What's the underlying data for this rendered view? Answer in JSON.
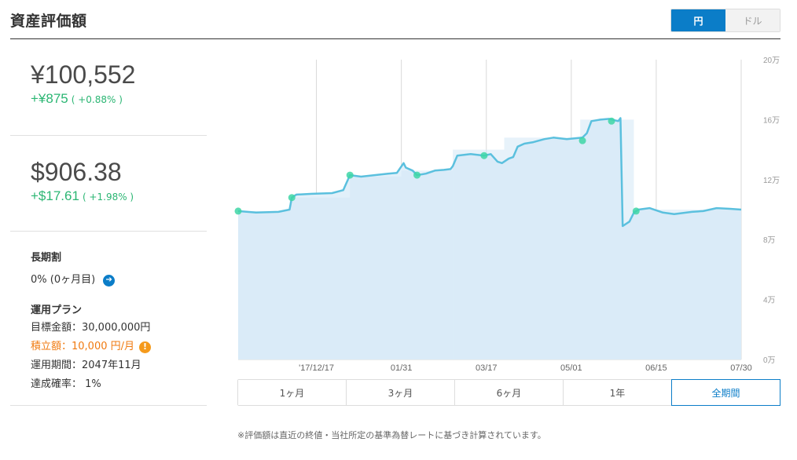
{
  "header": {
    "title": "資産評価額",
    "currency_yen": "円",
    "currency_dollar": "ドル"
  },
  "summary": {
    "yen_value": "¥100,552",
    "yen_change": "+¥875",
    "yen_change_pct": "( +0.88% )",
    "usd_value": "$906.38",
    "usd_change": "+$17.61",
    "usd_change_pct": "( +1.98% )"
  },
  "long_term": {
    "title": "長期割",
    "value": "0% (0ヶ月目)"
  },
  "plan": {
    "title": "運用プラン",
    "target": "目標金額：30,000,000円",
    "monthly": "積立額：10,000 円/月",
    "period": "運用期間：2047年11月",
    "probability": "達成確率： 1%"
  },
  "chart_data": {
    "type": "area",
    "y_ticks": [
      "20万",
      "16万",
      "12万",
      "8万",
      "4万",
      "0万"
    ],
    "y_tick_values": [
      200000,
      160000,
      120000,
      80000,
      40000,
      0
    ],
    "x_ticks": [
      "'17/12/17",
      "01/31",
      "03/17",
      "05/01",
      "06/15",
      "07/30"
    ],
    "ylim": [
      0,
      200000
    ],
    "xlim": [
      0,
      225
    ],
    "x_tick_values": [
      35,
      73,
      111,
      149,
      187,
      225
    ],
    "line": [
      [
        0,
        99000
      ],
      [
        8,
        98000
      ],
      [
        18,
        98500
      ],
      [
        23,
        100000
      ],
      [
        24,
        108000
      ],
      [
        26,
        110000
      ],
      [
        33,
        110500
      ],
      [
        42,
        111000
      ],
      [
        47,
        113000
      ],
      [
        50,
        123000
      ],
      [
        55,
        122000
      ],
      [
        67,
        124000
      ],
      [
        71,
        124500
      ],
      [
        74,
        131000
      ],
      [
        75,
        128000
      ],
      [
        78,
        126000
      ],
      [
        80,
        123000
      ],
      [
        84,
        124000
      ],
      [
        88,
        126000
      ],
      [
        92,
        126500
      ],
      [
        95,
        127000
      ],
      [
        96,
        129000
      ],
      [
        98,
        136000
      ],
      [
        104,
        137000
      ],
      [
        110,
        136000
      ],
      [
        113,
        137000
      ],
      [
        116,
        132000
      ],
      [
        118,
        131000
      ],
      [
        121,
        134000
      ],
      [
        123,
        135000
      ],
      [
        125,
        142000
      ],
      [
        128,
        144000
      ],
      [
        132,
        145000
      ],
      [
        137,
        147000
      ],
      [
        141,
        148000
      ],
      [
        147,
        147000
      ],
      [
        154,
        148000
      ],
      [
        156,
        151000
      ],
      [
        158,
        159000
      ],
      [
        162,
        160000
      ],
      [
        166,
        160500
      ],
      [
        170,
        159000
      ],
      [
        171,
        161000
      ],
      [
        172,
        89000
      ],
      [
        175,
        92000
      ],
      [
        177,
        98000
      ],
      [
        179,
        100000
      ],
      [
        184,
        101000
      ],
      [
        190,
        98000
      ],
      [
        195,
        97000
      ],
      [
        203,
        98500
      ],
      [
        208,
        99000
      ],
      [
        214,
        101000
      ],
      [
        220,
        100500
      ],
      [
        225,
        100000
      ]
    ],
    "steps": [
      [
        0,
        23,
        99000
      ],
      [
        23,
        50,
        108000
      ],
      [
        50,
        73,
        122000
      ],
      [
        73,
        96,
        126000
      ],
      [
        96,
        119,
        140000
      ],
      [
        119,
        153,
        148000
      ],
      [
        153,
        177,
        160000
      ],
      [
        177,
        225,
        100000
      ]
    ],
    "markers": [
      [
        0,
        99000
      ],
      [
        24,
        108000
      ],
      [
        50,
        123000
      ],
      [
        80,
        123000
      ],
      [
        110,
        136000
      ],
      [
        154,
        146000
      ],
      [
        167,
        159000
      ],
      [
        178,
        99000
      ]
    ],
    "vgrid": [
      35,
      73,
      111,
      149,
      187,
      225
    ],
    "colors": {
      "line": "#5bc0de",
      "area": "#e2f0fa",
      "step": "#d4e7f6",
      "marker": "#3ed6a6",
      "grid": "#d9d9d9"
    }
  },
  "tabs": [
    "1ヶ月",
    "3ヶ月",
    "6ヶ月",
    "1年",
    "全期間"
  ],
  "note": "※評価額は直近の終値・当社所定の基準為替レートに基づき計算されています。"
}
